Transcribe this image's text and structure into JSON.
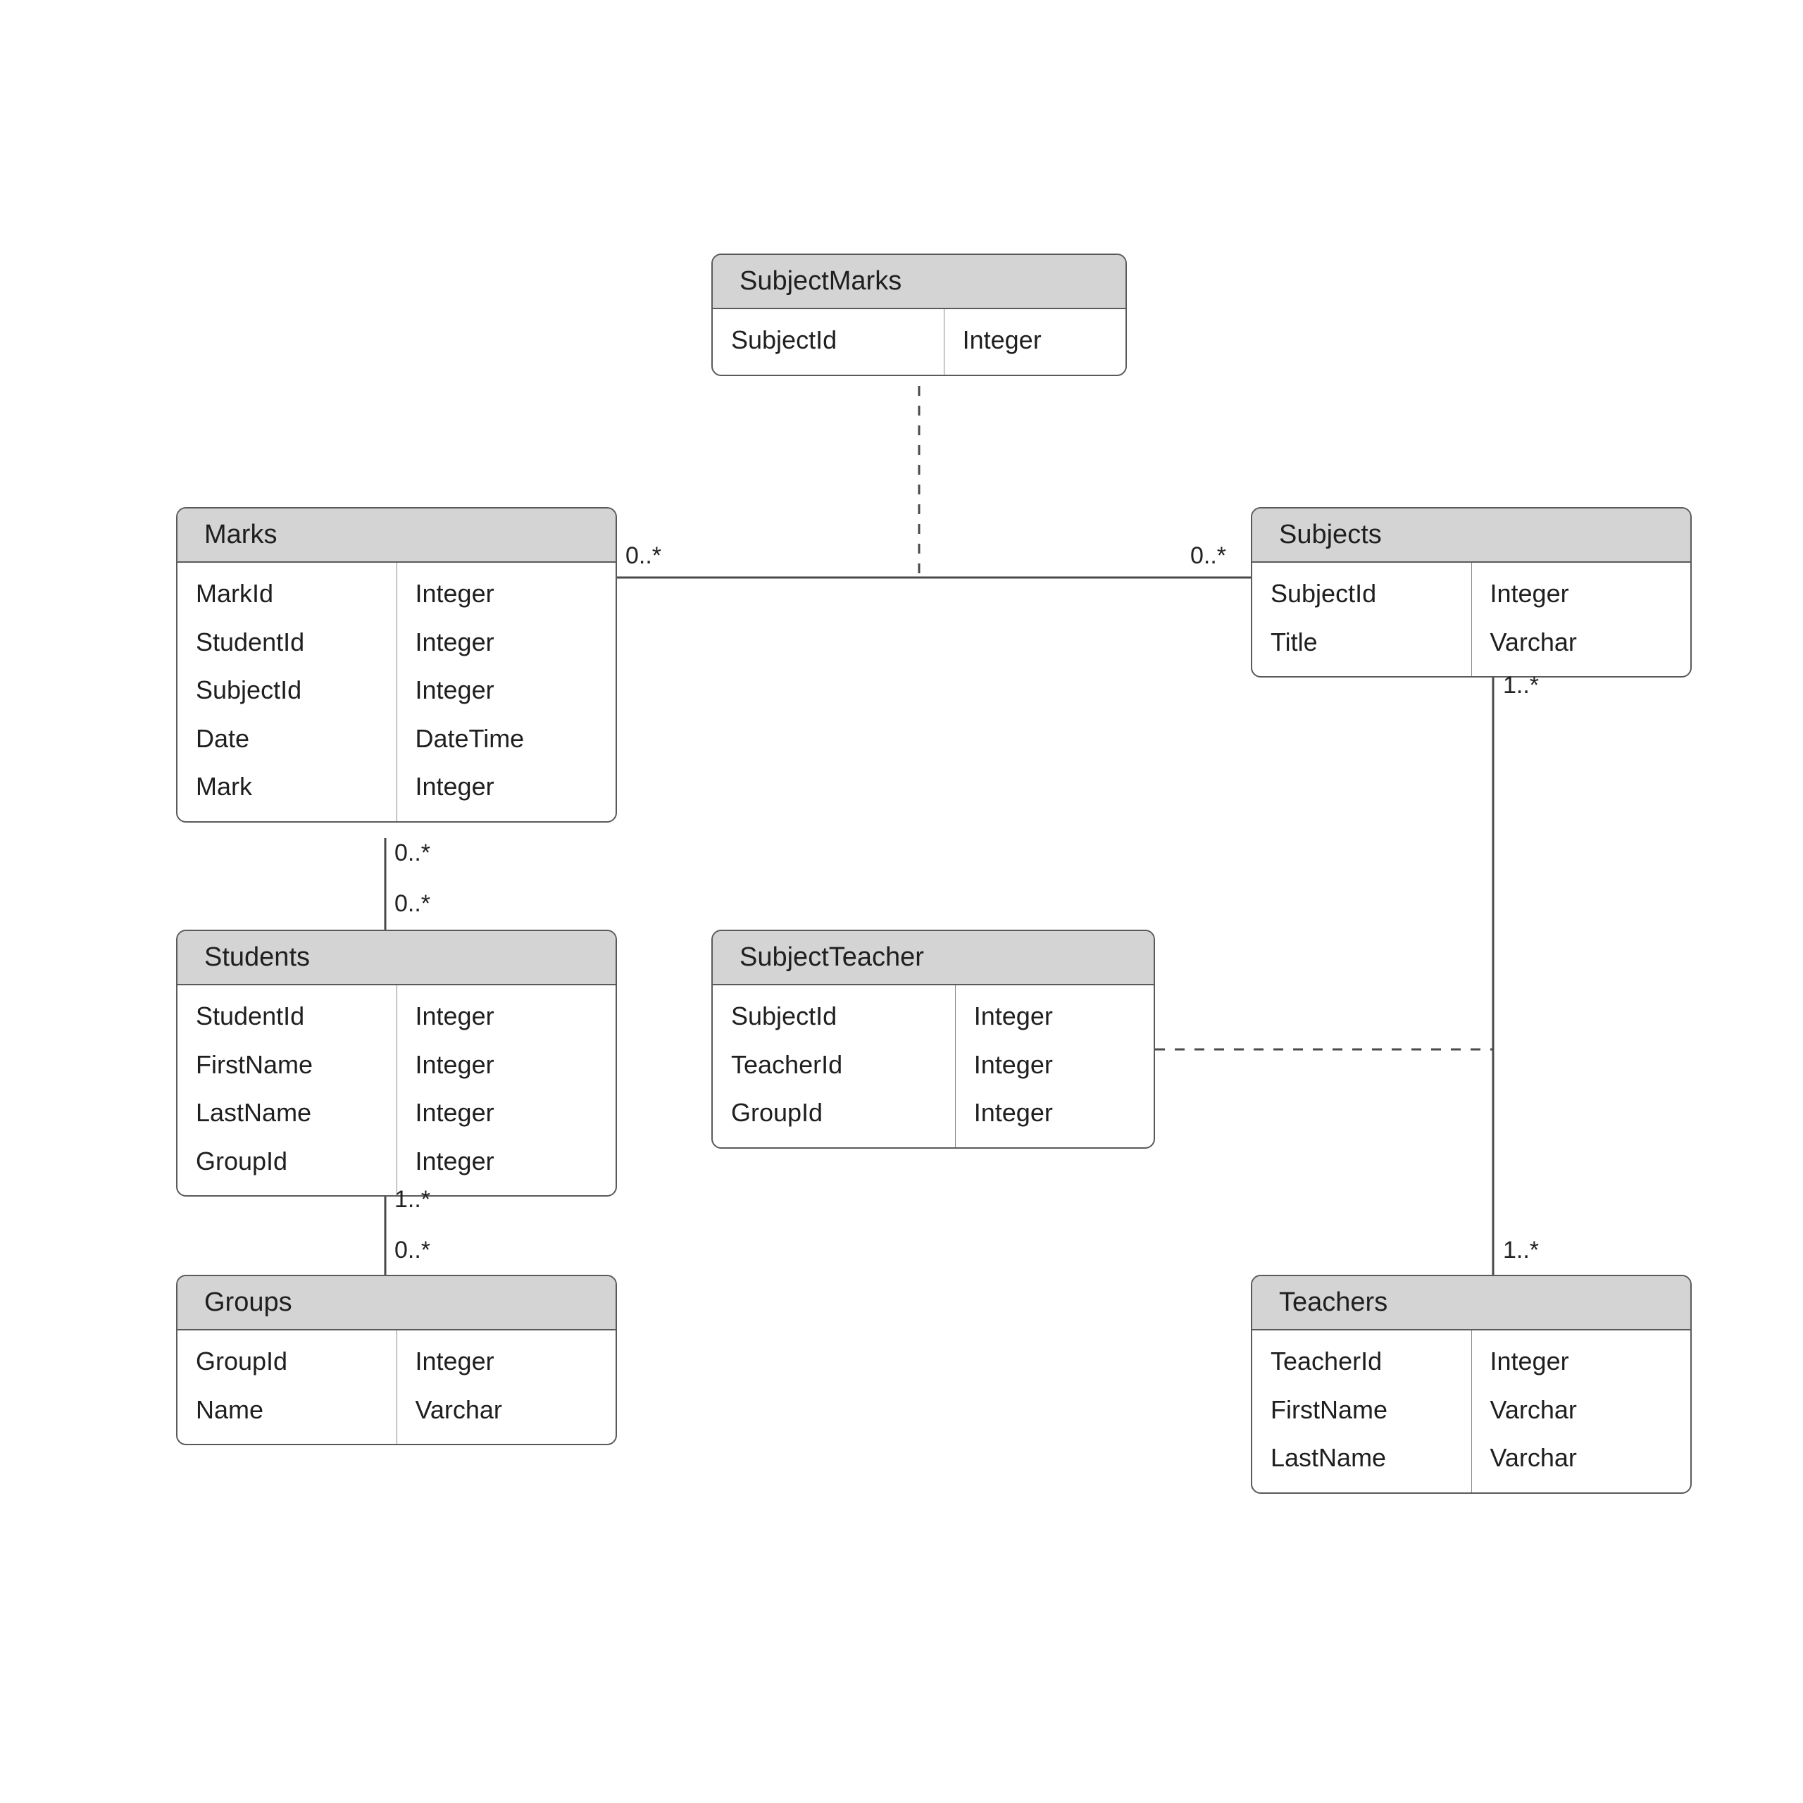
{
  "entities": {
    "subjectMarks": {
      "title": "SubjectMarks",
      "fields": [
        {
          "name": "SubjectId",
          "type": "Integer"
        }
      ]
    },
    "marks": {
      "title": "Marks",
      "fields": [
        {
          "name": "MarkId",
          "type": "Integer"
        },
        {
          "name": "StudentId",
          "type": "Integer"
        },
        {
          "name": "SubjectId",
          "type": "Integer"
        },
        {
          "name": "Date",
          "type": "DateTime"
        },
        {
          "name": "Mark",
          "type": "Integer"
        }
      ]
    },
    "subjects": {
      "title": "Subjects",
      "fields": [
        {
          "name": "SubjectId",
          "type": "Integer"
        },
        {
          "name": "Title",
          "type": "Varchar"
        }
      ]
    },
    "students": {
      "title": "Students",
      "fields": [
        {
          "name": "StudentId",
          "type": "Integer"
        },
        {
          "name": "FirstName",
          "type": "Integer"
        },
        {
          "name": "LastName",
          "type": "Integer"
        },
        {
          "name": "GroupId",
          "type": "Integer"
        }
      ]
    },
    "subjectTeacher": {
      "title": "SubjectTeacher",
      "fields": [
        {
          "name": "SubjectId",
          "type": "Integer"
        },
        {
          "name": "TeacherId",
          "type": "Integer"
        },
        {
          "name": "GroupId",
          "type": "Integer"
        }
      ]
    },
    "groups": {
      "title": "Groups",
      "fields": [
        {
          "name": "GroupId",
          "type": "Integer"
        },
        {
          "name": "Name",
          "type": "Varchar"
        }
      ]
    },
    "teachers": {
      "title": "Teachers",
      "fields": [
        {
          "name": "TeacherId",
          "type": "Integer"
        },
        {
          "name": "FirstName",
          "type": "Varchar"
        },
        {
          "name": "LastName",
          "type": "Varchar"
        }
      ]
    }
  },
  "multiplicities": {
    "marks_subjects_left": "0..*",
    "marks_subjects_right": "0..*",
    "marks_students_top": "0..*",
    "marks_students_bottom": "0..*",
    "students_groups_top": "1..*",
    "students_groups_bottom": "0..*",
    "subjects_teachers_top": "1..*",
    "subjects_teachers_bottom": "1..*"
  }
}
